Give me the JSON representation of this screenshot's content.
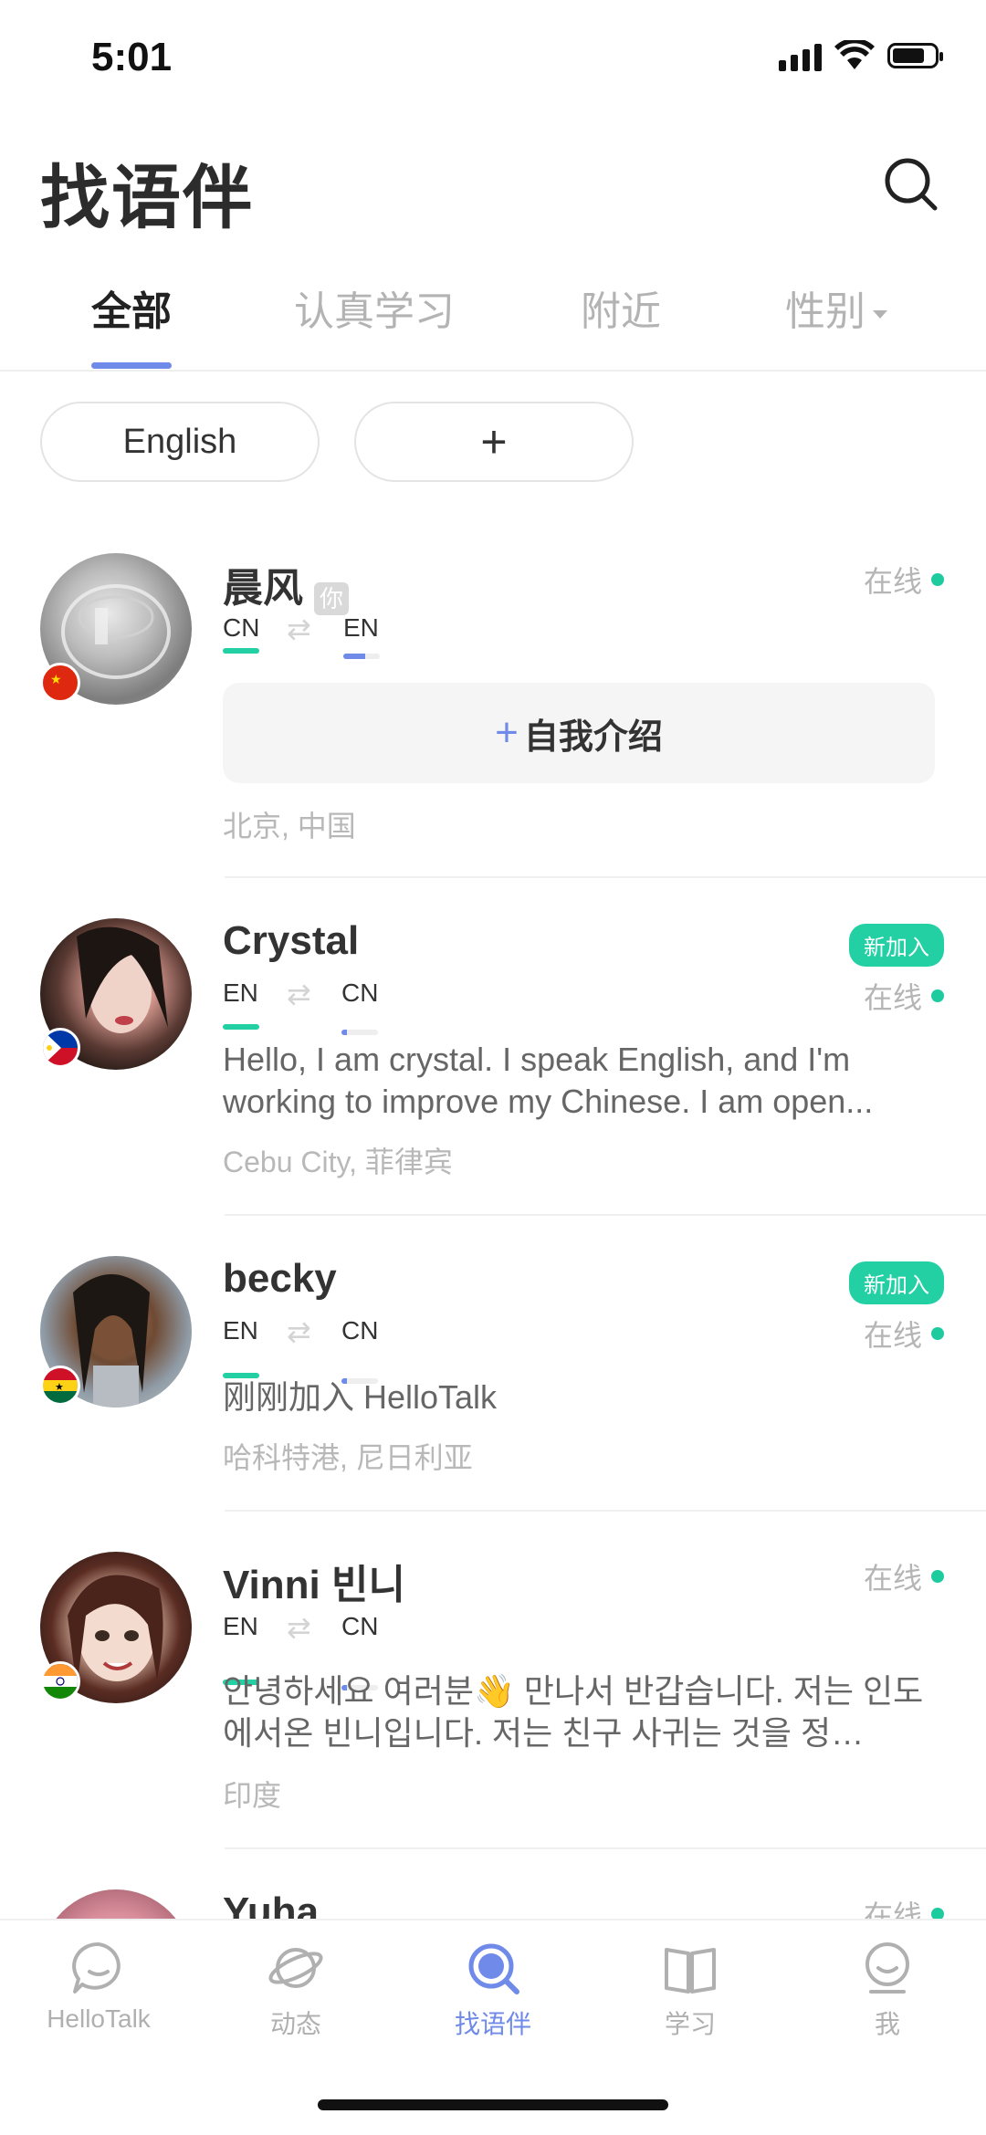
{
  "status_bar": {
    "time": "5:01"
  },
  "header": {
    "title": "找语伴"
  },
  "tabs": [
    {
      "label": "全部"
    },
    {
      "label": "认真学习"
    },
    {
      "label": "附近"
    },
    {
      "label": "性别"
    }
  ],
  "filters": {
    "language_chip": "English",
    "add_chip": "+"
  },
  "users": [
    {
      "name": "晨风",
      "you_badge": "你",
      "native": "CN",
      "learning": "EN",
      "learning_level": 0.6,
      "status": "在线",
      "intro_button": "自我介绍",
      "location": "北京, 中国"
    },
    {
      "name": "Crystal",
      "new_badge": "新加入",
      "native": "EN",
      "learning": "CN",
      "learning_level": 0.15,
      "status": "在线",
      "bio": "Hello, I am crystal. I speak English, and I'm working to improve my Chinese. I am open...",
      "location": "Cebu City, 菲律宾"
    },
    {
      "name": "becky",
      "new_badge": "新加入",
      "native": "EN",
      "learning": "CN",
      "learning_level": 0.15,
      "status": "在线",
      "bio": "刚刚加入 HelloTalk",
      "location": "哈科特港, 尼日利亚"
    },
    {
      "name": "Vinni 빈니",
      "native": "EN",
      "learning": "CN",
      "learning_level": 0.15,
      "status": "在线",
      "bio": "안녕하세요 여러분👋 만나서 반갑습니다. 저는 인도에서온 빈니입니다. 저는 친구 사귀는 것을 정…",
      "location": "印度"
    },
    {
      "name": "Yuha",
      "status": "在线"
    }
  ],
  "bottom_nav": [
    {
      "label": "HelloTalk",
      "icon": "chat-bubble-icon"
    },
    {
      "label": "动态",
      "icon": "planet-icon"
    },
    {
      "label": "找语伴",
      "icon": "search-icon"
    },
    {
      "label": "学习",
      "icon": "book-icon"
    },
    {
      "label": "我",
      "icon": "profile-icon"
    }
  ],
  "colors": {
    "accent": "#6f8ae8",
    "online": "#1ecb9f",
    "new_badge": "#22d0a4"
  }
}
